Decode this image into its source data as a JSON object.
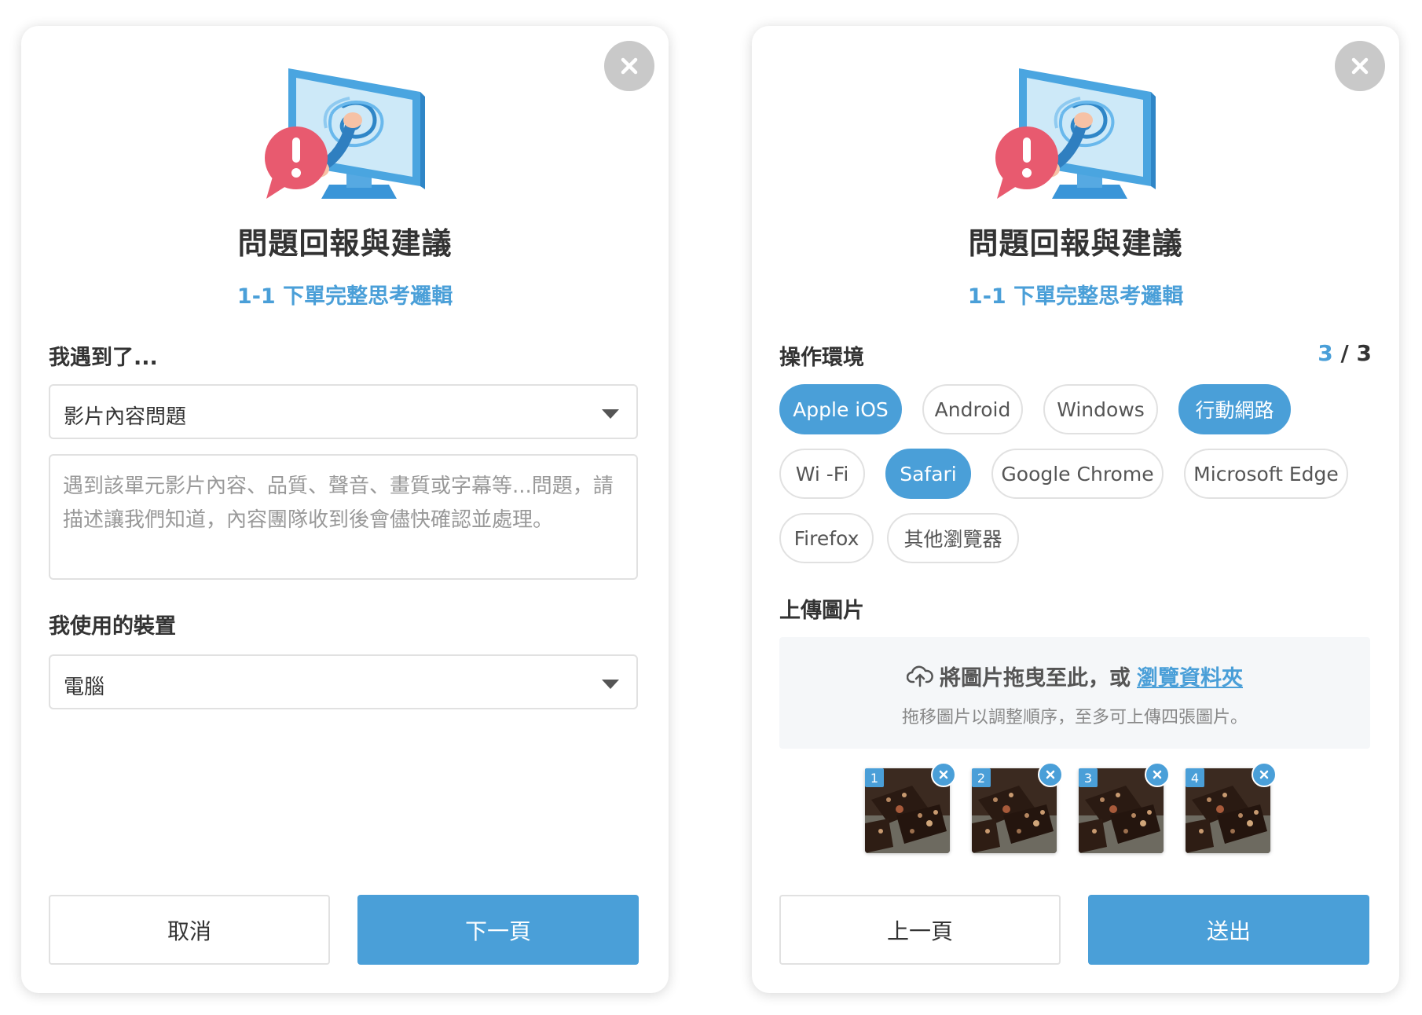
{
  "colors": {
    "accent": "#4a9fd8",
    "close_bg": "#c9c9c9",
    "border": "#e1e1e1",
    "dropzone_bg": "#f5f7f9"
  },
  "icons": {
    "close": "close-icon",
    "illustration": "monitor-alert-illustration",
    "caret": "caret-down-icon",
    "upload": "cloud-upload-icon",
    "remove": "remove-icon"
  },
  "card1": {
    "title": "問題回報與建議",
    "subtitle": "1-1 下單完整思考邏輯",
    "issue_label": "我遇到了...",
    "issue_select_value": "影片內容問題",
    "description_placeholder": "遇到該單元影片內容、品質、聲音、畫質或字幕等...問題，請描述讓我們知道，內容團隊收到後會儘快確認並處理。",
    "device_label": "我使用的裝置",
    "device_select_value": "電腦",
    "cancel_label": "取消",
    "next_label": "下一頁"
  },
  "card2": {
    "title": "問題回報與建議",
    "subtitle": "1-1 下單完整思考邏輯",
    "env_label": "操作環境",
    "step_current": "3",
    "step_total": "/ 3",
    "chips": [
      {
        "label": "Apple iOS",
        "selected": true
      },
      {
        "label": "Android",
        "selected": false
      },
      {
        "label": "Windows",
        "selected": false
      },
      {
        "label": "行動網路",
        "selected": true
      },
      {
        "label": "Wi -Fi",
        "selected": false
      },
      {
        "label": "Safari",
        "selected": true
      },
      {
        "label": "Google Chrome",
        "selected": false
      },
      {
        "label": "Microsoft Edge",
        "selected": false
      },
      {
        "label": "Firefox",
        "selected": false
      },
      {
        "label": "其他瀏覽器",
        "selected": false
      }
    ],
    "upload_label": "上傳圖片",
    "dropzone_text": "將圖片拖曳至此，或",
    "dropzone_link": "瀏覽資料夾",
    "dropzone_hint": "拖移圖片以調整順序，至多可上傳四張圖片。",
    "thumbnails": [
      {
        "number": "1"
      },
      {
        "number": "2"
      },
      {
        "number": "3"
      },
      {
        "number": "4"
      }
    ],
    "prev_label": "上一頁",
    "submit_label": "送出"
  }
}
